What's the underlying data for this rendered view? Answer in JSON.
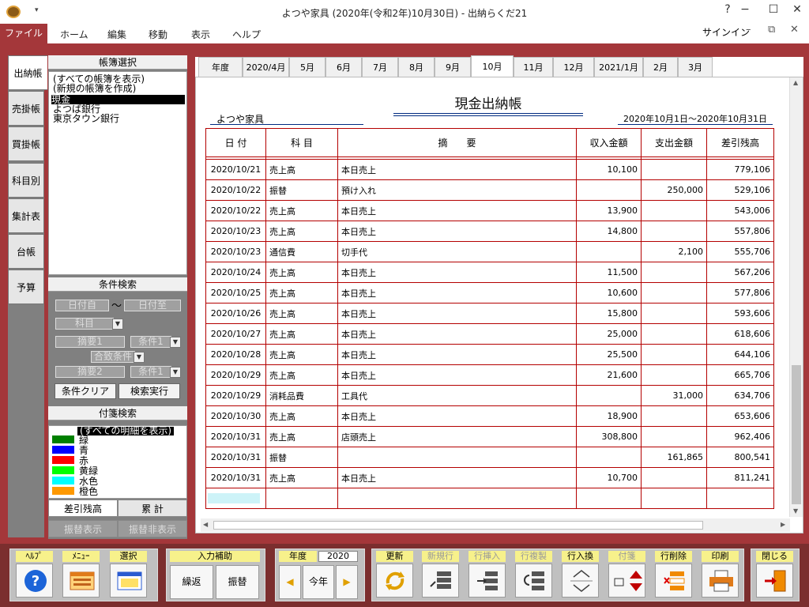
{
  "window": {
    "title": "よつや家具 (2020年(令和2年)10月30日) - 出納らくだ21",
    "qa_arrow": "▾",
    "help": "?",
    "minimize": "−",
    "maximize": "☐",
    "close": "✕"
  },
  "menu": {
    "file": "ファイル",
    "items": [
      "ホーム",
      "編集",
      "移動",
      "表示",
      "ヘルプ"
    ],
    "signin": "サインイン",
    "restore_min": "–",
    "restore": "⧉",
    "close": "✕"
  },
  "side_tabs": [
    "出納帳",
    "売掛帳",
    "買掛帳",
    "科目別",
    "集計表",
    "台帳",
    "予算"
  ],
  "book_select": {
    "header": "帳簿選択",
    "items": [
      "(すべての帳簿を表示)",
      "(新規の帳簿を作成)",
      "現金",
      "よつば銀行",
      "東京タウン銀行"
    ],
    "selected": 2
  },
  "search": {
    "header": "条件検索",
    "date_from": "日付自",
    "tilde": "〜",
    "date_to": "日付至",
    "subject": "科目",
    "summary1": "摘要1",
    "cond1": "条件1",
    "match_cond": "合致条件",
    "summary2": "摘要2",
    "cond2": "条件1",
    "clear_btn": "条件クリア",
    "exec_btn": "検索実行"
  },
  "tag_search": {
    "header": "付箋検索",
    "all": "(すべての明細を表示)",
    "tags": [
      {
        "label": "緑",
        "color": "#008000"
      },
      {
        "label": "青",
        "color": "#0000ff"
      },
      {
        "label": "赤",
        "color": "#ff0000"
      },
      {
        "label": "黄緑",
        "color": "#00ff00"
      },
      {
        "label": "水色",
        "color": "#00ffff"
      },
      {
        "label": "橙色",
        "color": "#ff9900"
      }
    ]
  },
  "bottom_tabs": {
    "balance": "差引残高",
    "total": "累 計",
    "transfer_show": "振替表示",
    "transfer_hide": "振替非表示"
  },
  "month_tabs": [
    "年度",
    "2020/4月",
    "5月",
    "6月",
    "7月",
    "8月",
    "9月",
    "10月",
    "11月",
    "12月",
    "2021/1月",
    "2月",
    "3月"
  ],
  "active_month": "10月",
  "ledger": {
    "title": "現金出納帳",
    "company": "よつや家具",
    "period": "2020年10月1日〜2020年10月31日",
    "headers": {
      "date": "日 付",
      "subject": "科 目",
      "summary": "摘　　要",
      "income": "収入金額",
      "expense": "支出金額",
      "balance": "差引残高"
    },
    "rows": [
      {
        "date": "2020/10/21",
        "subject": "売上高",
        "summary": "本日売上",
        "income": "10,100",
        "expense": "",
        "balance": "779,106"
      },
      {
        "date": "2020/10/22",
        "subject": "振替",
        "summary": "預け入れ",
        "income": "",
        "expense": "250,000",
        "balance": "529,106"
      },
      {
        "date": "2020/10/22",
        "subject": "売上高",
        "summary": "本日売上",
        "income": "13,900",
        "expense": "",
        "balance": "543,006"
      },
      {
        "date": "2020/10/23",
        "subject": "売上高",
        "summary": "本日売上",
        "income": "14,800",
        "expense": "",
        "balance": "557,806"
      },
      {
        "date": "2020/10/23",
        "subject": "通信費",
        "summary": "切手代",
        "income": "",
        "expense": "2,100",
        "balance": "555,706"
      },
      {
        "date": "2020/10/24",
        "subject": "売上高",
        "summary": "本日売上",
        "income": "11,500",
        "expense": "",
        "balance": "567,206"
      },
      {
        "date": "2020/10/25",
        "subject": "売上高",
        "summary": "本日売上",
        "income": "10,600",
        "expense": "",
        "balance": "577,806"
      },
      {
        "date": "2020/10/26",
        "subject": "売上高",
        "summary": "本日売上",
        "income": "15,800",
        "expense": "",
        "balance": "593,606"
      },
      {
        "date": "2020/10/27",
        "subject": "売上高",
        "summary": "本日売上",
        "income": "25,000",
        "expense": "",
        "balance": "618,606"
      },
      {
        "date": "2020/10/28",
        "subject": "売上高",
        "summary": "本日売上",
        "income": "25,500",
        "expense": "",
        "balance": "644,106"
      },
      {
        "date": "2020/10/29",
        "subject": "売上高",
        "summary": "本日売上",
        "income": "21,600",
        "expense": "",
        "balance": "665,706"
      },
      {
        "date": "2020/10/29",
        "subject": "消耗品費",
        "summary": "工具代",
        "income": "",
        "expense": "31,000",
        "balance": "634,706"
      },
      {
        "date": "2020/10/30",
        "subject": "売上高",
        "summary": "本日売上",
        "income": "18,900",
        "expense": "",
        "balance": "653,606"
      },
      {
        "date": "2020/10/31",
        "subject": "売上高",
        "summary": "店頭売上",
        "income": "308,800",
        "expense": "",
        "balance": "962,406"
      },
      {
        "date": "2020/10/31",
        "subject": "振替",
        "summary": "",
        "income": "",
        "expense": "161,865",
        "balance": "800,541"
      },
      {
        "date": "2020/10/31",
        "subject": "売上高",
        "summary": "本日売上",
        "income": "10,700",
        "expense": "",
        "balance": "811,241"
      }
    ]
  },
  "toolbar": {
    "help": "ﾍﾙﾌﾟ",
    "menu": "ﾒﾆｭｰ",
    "select": "選択",
    "input_assist": "入力補助",
    "repeat": "繰返",
    "transfer": "振替",
    "fiscal_year": "年度",
    "year_value": "2020",
    "this_year": "今年",
    "refresh": "更新",
    "new_row": "新規行",
    "insert_row": "行挿入",
    "copy_row": "行複製",
    "swap_row": "行入換",
    "tag": "付箋",
    "delete_row": "行削除",
    "print": "印刷",
    "close": "閉じる"
  },
  "colors": {
    "accent": "#a4373a",
    "bottom_bar": "#7b2e2e",
    "grid_red": "#b40000",
    "label_yellow": "#f7f18b"
  }
}
